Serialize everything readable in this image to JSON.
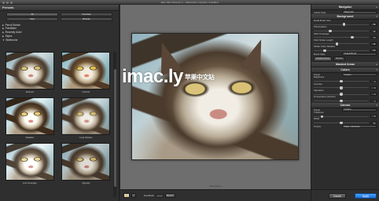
{
  "window": {
    "title": "Alien Skin Snap Art 4 – Watercolor | Vignette: ImacMod"
  },
  "left_panel": {
    "title": "Presets",
    "buttons": [
      "All",
      "Favorites",
      "User",
      "Browse"
    ],
    "list": [
      {
        "label": "Pencil Sketch",
        "open": false
      },
      {
        "label": "Pointillism",
        "open": false
      },
      {
        "label": "Recently Used",
        "open": false
      },
      {
        "label": "Styles",
        "open": false
      },
      {
        "label": "Watercolor",
        "open": true
      }
    ],
    "thumbs": [
      {
        "caption": "Abstract"
      },
      {
        "caption": "Colorful"
      },
      {
        "caption": "Detailed"
      },
      {
        "caption": "Long Strokes"
      },
      {
        "caption": "Low Coverage"
      },
      {
        "caption": "Vignette"
      }
    ]
  },
  "canvas": {
    "watermark": "imac.ly",
    "watermark_zh": "苹果中文站",
    "image_size": "1600x1200 px"
  },
  "bottombar": {
    "feedback_label": "Feedback",
    "before_label": "Before"
  },
  "right_panel": {
    "navigator": "Navigator",
    "artistic_style_label": "Artistic Style",
    "artistic_style_value": "Watercolor",
    "sections": {
      "background": "Background",
      "masked_areas": "Masked Areas",
      "colors": "Colors",
      "canvas": "Canvas"
    },
    "bg_controls": [
      {
        "label": "Detail Brush Size",
        "value": "50",
        "pos": 0.55
      },
      {
        "label": "Photorealism",
        "value": "30",
        "pos": 0.3
      },
      {
        "label": "Paint Coverage",
        "value": "70",
        "pos": 0.7
      },
      {
        "label": "Paint Stroke Length",
        "value": "42",
        "pos": 0.42
      },
      {
        "label": "Stroke Color Variation",
        "value": "20",
        "pos": 0.2
      }
    ],
    "brush_style_label": "Brush Style",
    "brush_style_value": "Default Brush",
    "tabs": [
      "Detailed Areas",
      "Masked"
    ],
    "preset_label": "Preset",
    "preset_value": "Custom",
    "color_controls": [
      {
        "label": "Brightness",
        "value": "0",
        "pos": 0.5
      },
      {
        "label": "Contrast",
        "value": "0",
        "pos": 0.5
      },
      {
        "label": "Saturation",
        "value": "0",
        "pos": 0.5
      },
      {
        "label": "Temperature (warmth)",
        "value": "0",
        "pos": 0.5
      }
    ],
    "canvas_label": "Preset",
    "canvas_value": "Custom",
    "canvas_controls": [
      {
        "label": "Thickness",
        "value": "0",
        "pos": 0.15
      },
      {
        "label": "Relief",
        "value": "50",
        "pos": 0.5
      }
    ],
    "texture_label": "Texture",
    "texture_value": "Paper, cold press",
    "cancel": "Cancel",
    "apply": "Apply"
  },
  "colors": {
    "accent": "#2a86ef",
    "panel": "#2d2d2d",
    "canvas": "#6e6e6e"
  }
}
